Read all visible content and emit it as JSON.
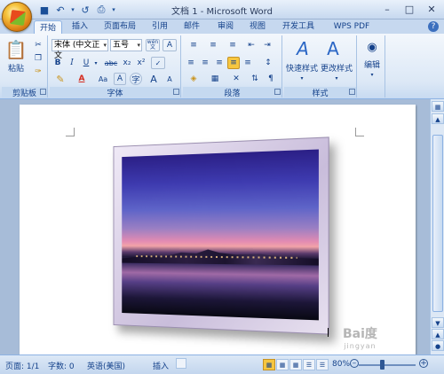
{
  "window": {
    "title": "文档 1 - Microsoft Word"
  },
  "quick_access": [
    "save-icon",
    "undo-icon",
    "redo-icon",
    "print-preview-icon"
  ],
  "tabs": [
    {
      "label": "开始",
      "active": true
    },
    {
      "label": "插入"
    },
    {
      "label": "页面布局"
    },
    {
      "label": "引用"
    },
    {
      "label": "邮件"
    },
    {
      "label": "审阅"
    },
    {
      "label": "视图"
    },
    {
      "label": "开发工具"
    },
    {
      "label": "WPS PDF"
    }
  ],
  "ribbon": {
    "clipboard": {
      "label": "剪贴板",
      "paste_label": "粘贴"
    },
    "font": {
      "label": "字体",
      "font_name": "宋体 (中文正文",
      "font_size": "五号",
      "wen_label": "wén",
      "bold": "B",
      "italic": "I",
      "underline": "U",
      "strike": "abc",
      "subscript": "x₂",
      "superscript": "x²",
      "clear": "Aa",
      "grow": "A",
      "shrink": "A"
    },
    "paragraph": {
      "label": "段落"
    },
    "styles": {
      "label": "样式",
      "quick_styles_label": "快速样式",
      "change_styles_label": "更改样式"
    },
    "editing": {
      "label": "编辑"
    }
  },
  "status": {
    "page": "页面: 1/1",
    "words": "字数: 0",
    "language": "英语(美国)",
    "mode": "插入",
    "zoom": "80%",
    "zoom_level": 0.4
  },
  "watermark": {
    "brand": "Bai度",
    "sub": "jingyan"
  },
  "colors": {
    "accent": "#15428b",
    "ribbon": "#dce8f6",
    "highlight": "#f6c640"
  }
}
